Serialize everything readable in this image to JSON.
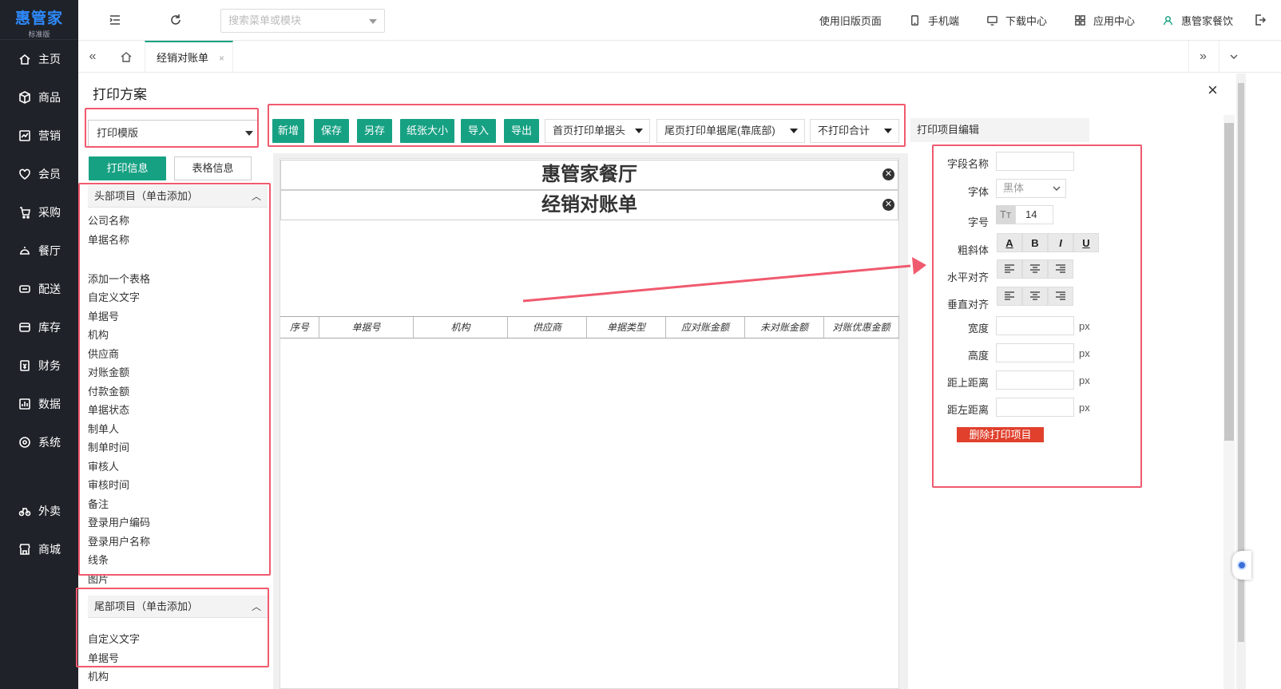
{
  "brand": {
    "name": "惠管家",
    "edition": "标准版"
  },
  "sidebar": {
    "items": [
      {
        "label": "主页",
        "icon": "home-icon"
      },
      {
        "label": "商品",
        "icon": "box-icon"
      },
      {
        "label": "营销",
        "icon": "chart-icon"
      },
      {
        "label": "会员",
        "icon": "heart-icon"
      },
      {
        "label": "采购",
        "icon": "cart-icon"
      },
      {
        "label": "餐厅",
        "icon": "cloche-icon"
      },
      {
        "label": "配送",
        "icon": "truck-icon"
      },
      {
        "label": "库存",
        "icon": "warehouse-icon"
      },
      {
        "label": "财务",
        "icon": "money-icon"
      },
      {
        "label": "数据",
        "icon": "bar-chart-icon"
      },
      {
        "label": "系统",
        "icon": "settings-icon"
      },
      {
        "label": "外卖",
        "icon": "bike-icon"
      },
      {
        "label": "商城",
        "icon": "shop-icon"
      }
    ]
  },
  "topbar": {
    "search_placeholder": "搜索菜单或模块",
    "links": [
      {
        "label": "使用旧版页面",
        "icon": ""
      },
      {
        "label": "手机端",
        "icon": "phone-icon"
      },
      {
        "label": "下载中心",
        "icon": "monitor-icon"
      },
      {
        "label": "应用中心",
        "icon": "grid-icon"
      },
      {
        "label": "惠管家餐饮",
        "icon": "user-icon"
      }
    ]
  },
  "tabs": {
    "active": "经销对账单",
    "close": "×"
  },
  "panel": {
    "title": "打印方案",
    "close": "×"
  },
  "template_select": {
    "value": "打印模版"
  },
  "toolbar": {
    "new": "新增",
    "save": "保存",
    "save_as": "另存",
    "paper_size": "纸张大小",
    "import": "导入",
    "export": "导出",
    "header_option": "首页打印单据头",
    "footer_option": "尾页打印单据尾(靠底部)",
    "total_option": "不打印合计"
  },
  "info_tabs": {
    "print_info": "打印信息",
    "table_info": "表格信息"
  },
  "header_items": {
    "title": "头部项目（单击添加）",
    "items": [
      "公司名称",
      "单据名称",
      "",
      "添加一个表格",
      "自定义文字",
      "单据号",
      "机构",
      "供应商",
      "对账金额",
      "付款金额",
      "单据状态",
      "制单人",
      "制单时间",
      "审核人",
      "审核时间",
      "备注",
      "登录用户编码",
      "登录用户名称",
      "线条",
      "图片"
    ]
  },
  "footer_items": {
    "title": "尾部项目（单击添加）",
    "items": [
      "自定义文字",
      "单据号",
      "机构"
    ]
  },
  "preview": {
    "company": "惠管家餐厅",
    "doc_title": "经销对账单",
    "columns": [
      "序号",
      "单据号",
      "机构",
      "供应商",
      "单据类型",
      "应对账金额",
      "未对账金额",
      "对账优惠金额"
    ]
  },
  "editor": {
    "title": "打印项目编辑",
    "field_name_label": "字段名称",
    "font_label": "字体",
    "font_value": "黑体",
    "size_label": "字号",
    "size_value": "14",
    "style_label": "粗斜体",
    "style_buttons": [
      "A",
      "B",
      "I",
      "U"
    ],
    "halign_label": "水平对齐",
    "valign_label": "垂直对齐",
    "width_label": "宽度",
    "height_label": "高度",
    "top_label": "距上距离",
    "left_label": "距左距离",
    "unit": "px",
    "delete_button": "删除打印项目"
  },
  "colors": {
    "accent": "#17a183",
    "sidebar_bg": "#1f2329",
    "danger": "#e0402c",
    "highlight": "#f05a6e"
  }
}
